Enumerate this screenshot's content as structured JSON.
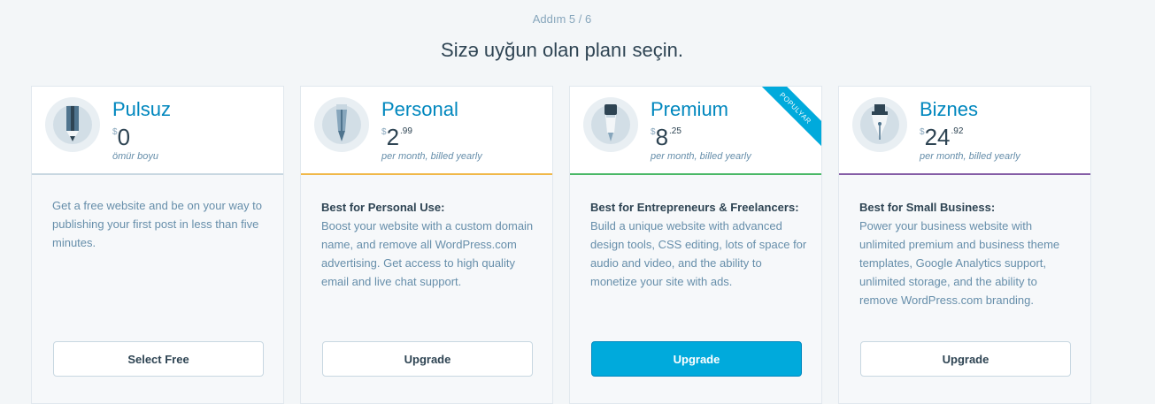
{
  "step": "Addım 5 / 6",
  "headline": "Sizə uyğun olan planı seçin.",
  "accents": {
    "free": "#c8d7e1",
    "personal": "#f0b849",
    "premium": "#4ab866",
    "business": "#855da6",
    "brand": "#0087be",
    "primary_button": "#00aadc"
  },
  "plans": [
    {
      "name": "Pulsuz",
      "currency": "$",
      "amount": "0",
      "cents": "",
      "period": "ömür boyu",
      "icon": "pencil-icon",
      "heading": "",
      "description": "Get a free website and be on your way to publishing your first post in less than five minutes.",
      "button": "Select Free"
    },
    {
      "name": "Personal",
      "currency": "$",
      "amount": "2",
      "cents": ".99",
      "period": "per month, billed yearly",
      "icon": "pen-icon",
      "heading": "Best for Personal Use:",
      "description": "Boost your website with a custom domain name, and remove all WordPress.com advertising. Get access to high quality email and live chat support.",
      "button": "Upgrade"
    },
    {
      "name": "Premium",
      "currency": "$",
      "amount": "8",
      "cents": ".25",
      "period": "per month, billed yearly",
      "icon": "marker-icon",
      "heading": "Best for Entrepreneurs & Freelancers:",
      "description": "Build a unique website with advanced design tools, CSS editing, lots of space for audio and video, and the ability to monetize your site with ads.",
      "button": "Upgrade",
      "ribbon": "Populyar"
    },
    {
      "name": "Biznes",
      "currency": "$",
      "amount": "24",
      "cents": ".92",
      "period": "per month, billed yearly",
      "icon": "fountain-pen-icon",
      "heading": "Best for Small Business:",
      "description": "Power your business website with unlimited premium and business theme templates, Google Analytics support, unlimited storage, and the ability to remove WordPress.com branding.",
      "button": "Upgrade"
    }
  ]
}
